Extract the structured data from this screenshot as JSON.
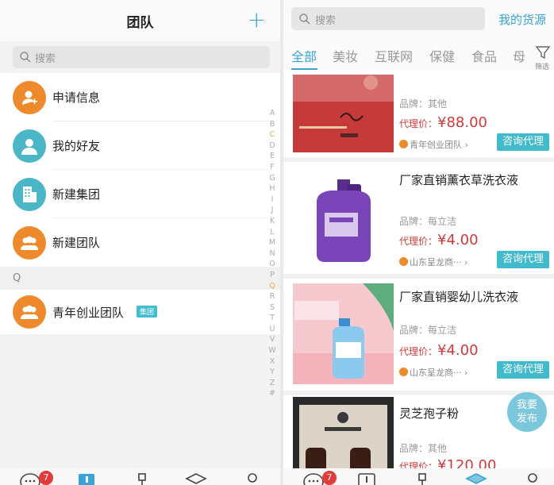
{
  "left": {
    "header": {
      "title": "团队",
      "plus_icon": "plus-icon"
    },
    "search": {
      "placeholder": "搜索"
    },
    "contacts": [
      {
        "label": "申请信息",
        "color": "#ee8a2b",
        "icon": "user-add-icon"
      },
      {
        "label": "我的好友",
        "color": "#4ab6c6",
        "icon": "user-icon"
      },
      {
        "label": "新建集团",
        "color": "#4ab6c6",
        "icon": "building-icon"
      },
      {
        "label": "新建团队",
        "color": "#ee8a2b",
        "icon": "users-icon"
      }
    ],
    "section_letter": "Q",
    "group": {
      "label": "青年创业团队",
      "badge": "集团",
      "icon": "users-icon"
    },
    "alphabet": [
      "A",
      "B",
      "C",
      "D",
      "E",
      "F",
      "G",
      "H",
      "I",
      "J",
      "K",
      "L",
      "M",
      "N",
      "O",
      "P",
      "Q",
      "R",
      "S",
      "T",
      "U",
      "V",
      "W",
      "X",
      "Y",
      "Z",
      "#"
    ],
    "tabbar": {
      "message_badge": "7"
    }
  },
  "right": {
    "search": {
      "placeholder": "搜索"
    },
    "my_resources": "我的货源",
    "categories": [
      "全部",
      "美妆",
      "互联网",
      "保健",
      "食品",
      "母"
    ],
    "filter_label": "筛选",
    "products": [
      {
        "name": "",
        "brand": "品牌：其他",
        "price_label": "代理价：",
        "price": "¥88.00",
        "store": "青年创业团队",
        "action": "咨询代理"
      },
      {
        "name": "厂家直销薰衣草洗衣液",
        "brand": "品牌：每立洁",
        "price_label": "代理价：",
        "price": "¥4.00",
        "store": "山东呈龙商···",
        "action": "咨询代理"
      },
      {
        "name": "厂家直销婴幼儿洗衣液",
        "brand": "品牌：每立洁",
        "price_label": "代理价：",
        "price": "¥4.00",
        "store": "山东呈龙商···",
        "action": "咨询代理"
      },
      {
        "name": "灵芝孢子粉",
        "brand": "品牌：其他",
        "price_label": "代理价：",
        "price": "¥120.00",
        "store": "",
        "action": ""
      }
    ],
    "publish_button": "我要\n发布",
    "tabbar": {
      "message_badge": "7"
    },
    "accent_color": "#3aa4d6",
    "price_color": "#d23a3a"
  }
}
